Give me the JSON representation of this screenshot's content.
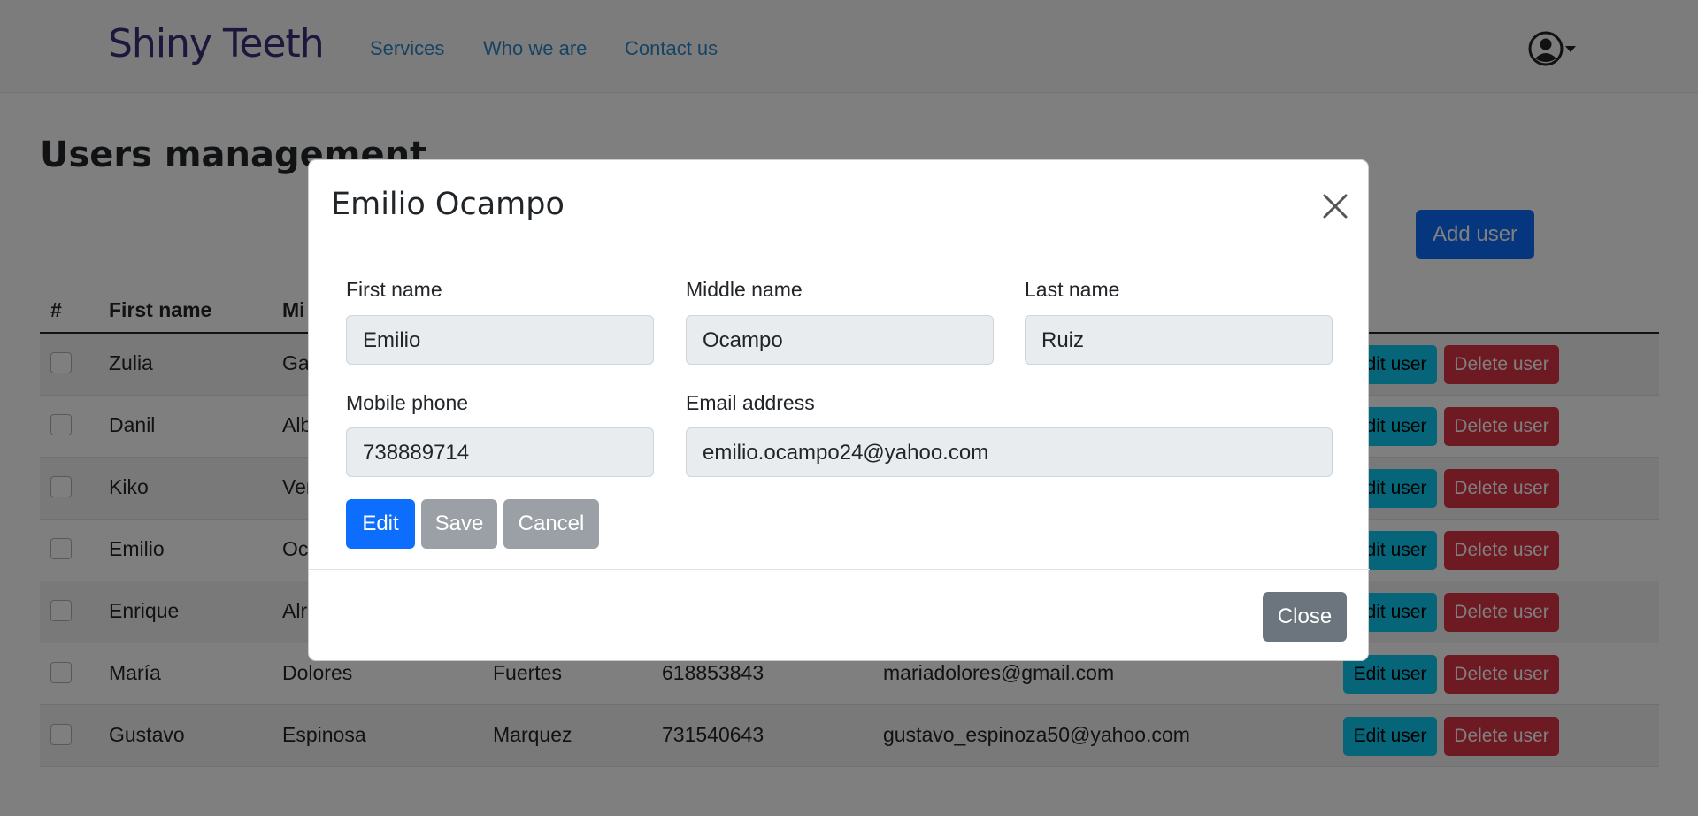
{
  "navbar": {
    "brand": "Shiny Teeth",
    "links": [
      "Services",
      "Who we are",
      "Contact us"
    ],
    "user_icon": "user-circle-icon"
  },
  "page": {
    "title": "Users management",
    "add_button": "Add user"
  },
  "table": {
    "headers": [
      "#",
      "First name",
      "Mi"
    ],
    "edit_label": "Edit user",
    "delete_label": "Delete user",
    "rows": [
      {
        "first": "Zulia",
        "middle": "Ga",
        "last": "",
        "phone": "",
        "email": ""
      },
      {
        "first": "Danil",
        "middle": "Alb",
        "last": "",
        "phone": "",
        "email": ""
      },
      {
        "first": "Kiko",
        "middle": "Ver",
        "last": "",
        "phone": "",
        "email": ""
      },
      {
        "first": "Emilio",
        "middle": "Oc",
        "last": "",
        "phone": "",
        "email": ""
      },
      {
        "first": "Enrique",
        "middle": "Alr",
        "last": "",
        "phone": "",
        "email": ""
      },
      {
        "first": "María",
        "middle": "Dolores",
        "last": "Fuertes",
        "phone": "618853843",
        "email": "mariadolores@gmail.com"
      },
      {
        "first": "Gustavo",
        "middle": "Espinosa",
        "last": "Marquez",
        "phone": "731540643",
        "email": "gustavo_espinoza50@yahoo.com"
      }
    ]
  },
  "modal": {
    "title": "Emilio Ocampo",
    "fields": {
      "first_name": {
        "label": "First name",
        "value": "Emilio"
      },
      "middle_name": {
        "label": "Middle name",
        "value": "Ocampo"
      },
      "last_name": {
        "label": "Last name",
        "value": "Ruiz"
      },
      "mobile_phone": {
        "label": "Mobile phone",
        "value": "738889714"
      },
      "email": {
        "label": "Email address",
        "value": "emilio.ocampo24@yahoo.com"
      }
    },
    "buttons": {
      "edit": "Edit",
      "save": "Save",
      "cancel": "Cancel",
      "close": "Close"
    }
  },
  "colors": {
    "primary": "#0d6efd",
    "info": "#0dcaf0",
    "danger": "#dc3545",
    "secondary": "#6c757d",
    "brand": "#3a2f7a",
    "link": "#2f86c7"
  }
}
